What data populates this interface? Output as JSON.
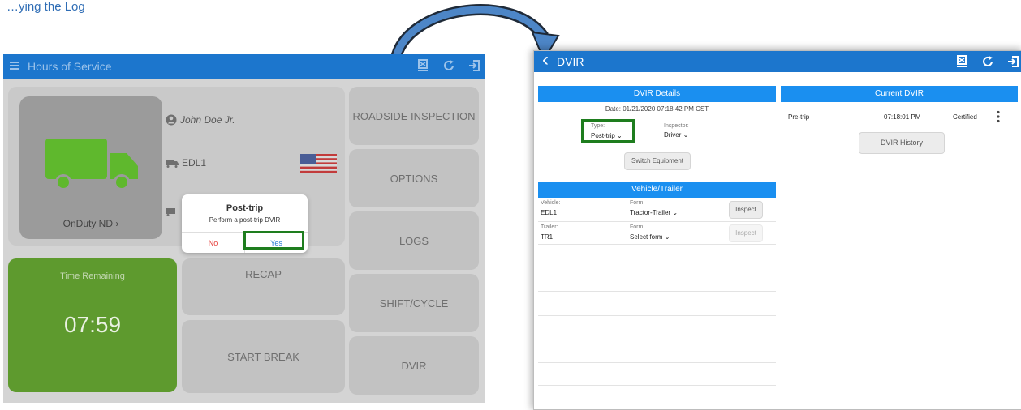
{
  "header_text": "…ying the Log",
  "left_screen": {
    "title": "Hours of Service",
    "driver_name": "John Doe Jr.",
    "vehicle": "EDL1",
    "status": "OnDuty ND",
    "status_chevron": "›",
    "time_remaining_label": "Time Remaining",
    "time_remaining_value": "07:59",
    "tiles": {
      "roadside_inspection": "ROADSIDE INSPECTION",
      "options": "OPTIONS",
      "logs": "LOGS",
      "shift_cycle": "SHIFT/CYCLE",
      "dvir": "DVIR",
      "recap": "RECAP",
      "start_break": "START BREAK"
    },
    "dialog": {
      "title": "Post-trip",
      "message": "Perform a post-trip DVIR",
      "no": "No",
      "yes": "Yes"
    }
  },
  "right_screen": {
    "title": "DVIR",
    "back_chevron": "‹",
    "dvir_details": {
      "heading": "DVIR Details",
      "date": "Date: 01/21/2020 07:18:42 PM CST",
      "type_label": "Type:",
      "type_value": "Post-trip",
      "inspector_label": "Inspector:",
      "inspector_value": "Driver",
      "switch_equipment": "Switch Equipment"
    },
    "vehicle_trailer": {
      "heading": "Vehicle/Trailer",
      "rows": [
        {
          "label": "Vehicle:",
          "value": "EDL1",
          "form_label": "Form:",
          "form_value": "Tractor-Trailer",
          "action": "Inspect"
        },
        {
          "label": "Trailer:",
          "value": "TR1",
          "form_label": "Form:",
          "form_value": "Select form",
          "action": "Inspect"
        }
      ]
    },
    "current_dvir": {
      "heading": "Current DVIR",
      "entry": {
        "type": "Pre-trip",
        "time": "07:18:01 PM",
        "status": "Certified"
      },
      "history_button": "DVIR History"
    }
  },
  "colors": {
    "app_bar": "#1c76cd",
    "section_header": "#1a8ff0",
    "truck_green": "#5fb82d",
    "time_tile_green": "#5e9a2e",
    "highlight_box": "#1e7d1e"
  },
  "icons": [
    "menu-icon",
    "device-icon",
    "refresh-icon",
    "logout-icon",
    "user-icon",
    "truck-icon",
    "us-flag-icon",
    "back-chevron-icon",
    "caret-down-icon",
    "more-vertical-icon"
  ]
}
